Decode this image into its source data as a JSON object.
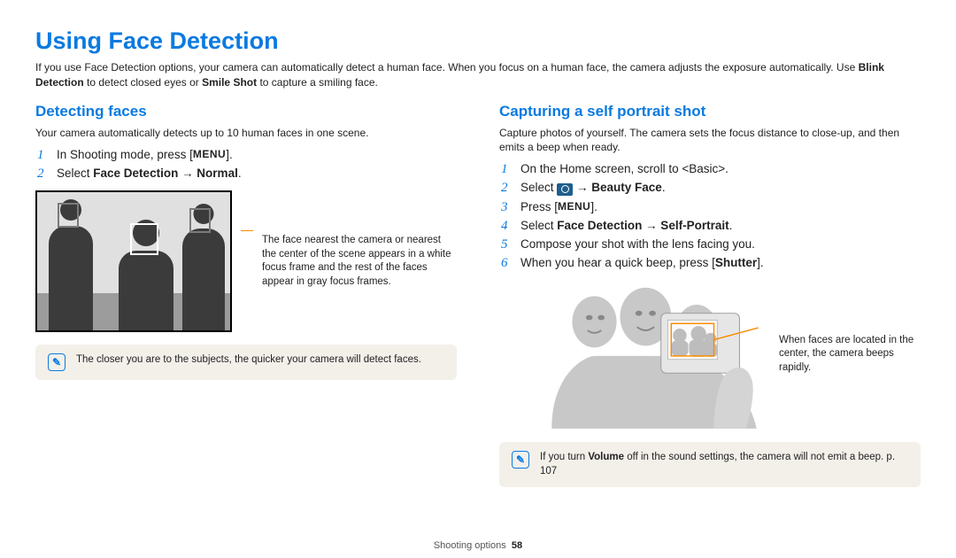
{
  "title": "Using Face Detection",
  "intro": {
    "line1_pre": "If you use Face Detection options, your camera can automatically detect a human face. When you focus on a human face, the camera adjusts the exposure automatically. Use ",
    "bold1": "Blink Detection",
    "mid1": " to detect closed eyes or ",
    "bold2": "Smile Shot",
    "mid2": " to capture a smiling face."
  },
  "left": {
    "heading": "Detecting faces",
    "sub": "Your camera automatically detects up to 10 human faces in one scene.",
    "step1_pre": "In Shooting mode, press [",
    "menu": "MENU",
    "step1_post": "].",
    "step2_pre": "Select ",
    "step2_bold": "Face Detection → Normal",
    "step2_post": ".",
    "fig_caption": "The face nearest the camera or nearest the center of the scene appears in a white focus frame and the rest of the faces appear in gray focus frames.",
    "note": "The closer you are to the subjects, the quicker your camera will detect faces."
  },
  "right": {
    "heading": "Capturing a self portrait shot",
    "sub": "Capture photos of yourself. The camera sets the focus distance to close-up, and then emits a beep when ready.",
    "step1": "On the Home screen, scroll to <Basic>.",
    "step2_pre": "Select ",
    "step2_bold": " → Beauty Face",
    "step2_post": ".",
    "step3_pre": "Press [",
    "step3_post": "].",
    "step4_pre": "Select ",
    "step4_bold": "Face Detection → Self-Portrait",
    "step4_post": ".",
    "step5": "Compose your shot with the lens facing you.",
    "step6_pre": "When you hear a quick beep, press [",
    "step6_bold": "Shutter",
    "step6_post": "].",
    "fig_caption": "When faces are located in the center, the camera beeps rapidly.",
    "note_pre": "If you turn ",
    "note_bold": "Volume",
    "note_post": " off in the sound settings, the camera will not emit a beep. p. 107"
  },
  "footer": {
    "section": "Shooting options",
    "page": "58"
  }
}
